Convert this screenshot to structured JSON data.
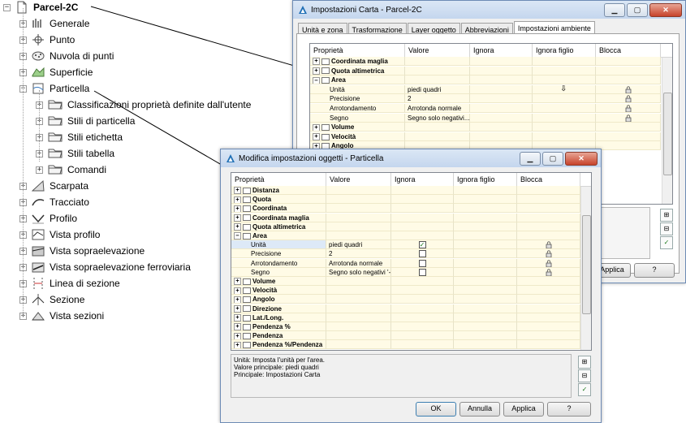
{
  "tree": {
    "root": "Parcel-2C",
    "items": [
      {
        "label": "Generale",
        "icon": "generale-icon",
        "level": 1,
        "expander": "+"
      },
      {
        "label": "Punto",
        "icon": "point-icon",
        "level": 1,
        "expander": "+"
      },
      {
        "label": "Nuvola di punti",
        "icon": "point-cloud-icon",
        "level": 1,
        "expander": "+"
      },
      {
        "label": "Superficie",
        "icon": "surface-icon",
        "level": 1,
        "expander": "+"
      },
      {
        "label": "Particella",
        "icon": "parcel-icon",
        "level": 1,
        "expander": "-"
      },
      {
        "label": "Classificazioni proprietà definite dall'utente",
        "icon": "folder-icon",
        "level": 2,
        "expander": "+"
      },
      {
        "label": "Stili di particella",
        "icon": "folder-icon",
        "level": 2,
        "expander": "+"
      },
      {
        "label": "Stili etichetta",
        "icon": "folder-icon",
        "level": 2,
        "expander": "+"
      },
      {
        "label": "Stili tabella",
        "icon": "folder-icon",
        "level": 2,
        "expander": "+"
      },
      {
        "label": "Comandi",
        "icon": "folder-icon",
        "level": 2,
        "expander": "+"
      },
      {
        "label": "Scarpata",
        "icon": "grading-icon",
        "level": 1,
        "expander": "+"
      },
      {
        "label": "Tracciato",
        "icon": "alignment-icon",
        "level": 1,
        "expander": "+"
      },
      {
        "label": "Profilo",
        "icon": "profile-icon",
        "level": 1,
        "expander": "+"
      },
      {
        "label": "Vista profilo",
        "icon": "profile-view-icon",
        "level": 1,
        "expander": "+"
      },
      {
        "label": "Vista sopraelevazione",
        "icon": "superelevation-view-icon",
        "level": 1,
        "expander": "+"
      },
      {
        "label": "Vista sopraelevazione ferroviaria",
        "icon": "rail-superelevation-icon",
        "level": 1,
        "expander": "+"
      },
      {
        "label": "Linea di sezione",
        "icon": "sample-line-icon",
        "level": 1,
        "expander": "+"
      },
      {
        "label": "Sezione",
        "icon": "section-icon",
        "level": 1,
        "expander": "+"
      },
      {
        "label": "Vista sezioni",
        "icon": "section-view-icon",
        "level": 1,
        "expander": "+"
      }
    ]
  },
  "win1": {
    "title": "Impostazioni Carta - Parcel-2C",
    "tabs": [
      "Unità e zona",
      "Trasformazione",
      "Layer oggetto",
      "Abbreviazioni",
      "Impostazioni ambiente"
    ],
    "headers": [
      "Proprietà",
      "Valore",
      "Ignora",
      "Ignora figlio",
      "Blocca"
    ],
    "rows": [
      {
        "label": "Coordinata maglia",
        "value": "",
        "type": "group",
        "exp": "+"
      },
      {
        "label": "Quota altimetrica",
        "value": "",
        "type": "group",
        "exp": "+"
      },
      {
        "label": "Area",
        "value": "",
        "type": "group",
        "exp": "-"
      },
      {
        "label": "Unità",
        "value": "piedi quadri",
        "type": "sub",
        "arrow": true,
        "lock": true
      },
      {
        "label": "Precisione",
        "value": "2",
        "type": "sub",
        "lock": true
      },
      {
        "label": "Arrotondamento",
        "value": "Arrotonda normale",
        "type": "sub",
        "lock": true
      },
      {
        "label": "Segno",
        "value": "Segno solo negativi...",
        "type": "sub",
        "lock": true
      },
      {
        "label": "Volume",
        "value": "",
        "type": "group",
        "exp": "+"
      },
      {
        "label": "Velocità",
        "value": "",
        "type": "group",
        "exp": "+"
      },
      {
        "label": "Angolo",
        "value": "",
        "type": "group",
        "exp": "+"
      }
    ],
    "apply": "Applica",
    "help": "?"
  },
  "win2": {
    "title": "Modifica impostazioni oggetti - Particella",
    "headers": [
      "Proprietà",
      "Valore",
      "Ignora",
      "Ignora figlio",
      "Blocca"
    ],
    "rows": [
      {
        "label": "Distanza",
        "value": "",
        "type": "group",
        "exp": "+"
      },
      {
        "label": "Quota",
        "value": "",
        "type": "group",
        "exp": "+"
      },
      {
        "label": "Coordinata",
        "value": "",
        "type": "group",
        "exp": "+"
      },
      {
        "label": "Coordinata maglia",
        "value": "",
        "type": "group",
        "exp": "+"
      },
      {
        "label": "Quota altimetrica",
        "value": "",
        "type": "group",
        "exp": "+"
      },
      {
        "label": "Area",
        "value": "",
        "type": "group",
        "exp": "-"
      },
      {
        "label": "Unità",
        "value": "piedi quadri",
        "type": "sub",
        "selected": true,
        "check": true,
        "checked": true,
        "lock": true
      },
      {
        "label": "Precisione",
        "value": "2",
        "type": "sub",
        "check": true,
        "checked": false,
        "lock": true
      },
      {
        "label": "Arrotondamento",
        "value": "Arrotonda normale",
        "type": "sub",
        "check": true,
        "checked": false,
        "lock": true
      },
      {
        "label": "Segno",
        "value": "Segno solo negativi '-'",
        "type": "sub",
        "check": true,
        "checked": false,
        "lock": true
      },
      {
        "label": "Volume",
        "value": "",
        "type": "group",
        "exp": "+"
      },
      {
        "label": "Velocità",
        "value": "",
        "type": "group",
        "exp": "+"
      },
      {
        "label": "Angolo",
        "value": "",
        "type": "group",
        "exp": "+"
      },
      {
        "label": "Direzione",
        "value": "",
        "type": "group",
        "exp": "+"
      },
      {
        "label": "Lat./Long.",
        "value": "",
        "type": "group",
        "exp": "+"
      },
      {
        "label": "Pendenza %",
        "value": "",
        "type": "group",
        "exp": "+"
      },
      {
        "label": "Pendenza",
        "value": "",
        "type": "group",
        "exp": "+"
      },
      {
        "label": "Pendenza %/Pendenza",
        "value": "",
        "type": "group",
        "exp": "+"
      }
    ],
    "info": [
      "Unità: Imposta l'unità per l'area.",
      "Valore principale: piedi quadri",
      "Principale: Impostazioni Carta"
    ],
    "ok": "OK",
    "cancel": "Annulla",
    "apply": "Applica",
    "help": "?"
  },
  "colors": {
    "accent": "#3c7fb1",
    "grid_row": "#fffbe6",
    "selected": "#dde9f7",
    "title": "#c4d6ee"
  }
}
